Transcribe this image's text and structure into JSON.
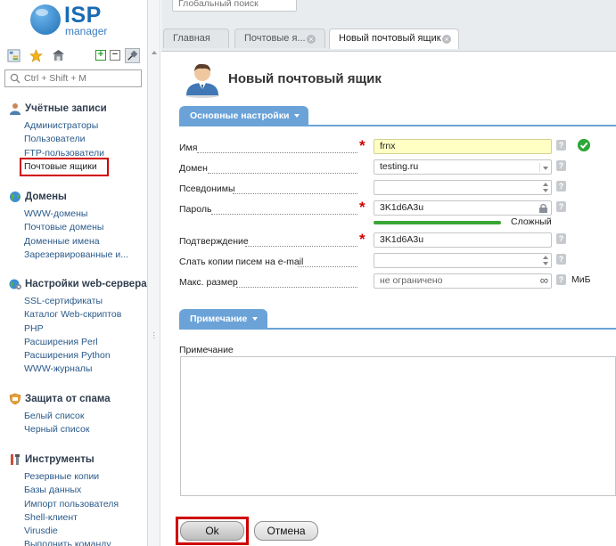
{
  "app": {
    "logo_main": "ISP",
    "logo_sub": "manager"
  },
  "toolbar_icons": [
    "tree-icon",
    "star-icon",
    "home-icon",
    "expand-icon",
    "collapse-icon",
    "pin-icon"
  ],
  "sidebar": {
    "search_placeholder": "Ctrl + Shift + M",
    "groups": [
      {
        "title": "Учётные записи",
        "icon": "users-icon",
        "items": [
          "Администраторы",
          "Пользователи",
          "FTP-пользователи",
          "Почтовые ящики"
        ]
      },
      {
        "title": "Домены",
        "icon": "globe-icon",
        "items": [
          "WWW-домены",
          "Почтовые домены",
          "Доменные имена",
          "Зарезервированные и..."
        ]
      },
      {
        "title": "Настройки web-сервера",
        "icon": "globe-gear-icon",
        "items": [
          "SSL-сертификаты",
          "Каталог Web-скриптов",
          "PHP",
          "Расширения Perl",
          "Расширения Python",
          "WWW-журналы"
        ]
      },
      {
        "title": "Защита от спама",
        "icon": "spam-shield-icon",
        "items": [
          "Белый список",
          "Черный список"
        ]
      },
      {
        "title": "Инструменты",
        "icon": "tools-icon",
        "items": [
          "Резервные копии",
          "Базы данных",
          "Импорт пользователя",
          "Shell-клиент",
          "Virusdie",
          "Выполнить команду"
        ]
      }
    ]
  },
  "top": {
    "global_search_placeholder": "Глобальный поиск"
  },
  "tabs": [
    {
      "label": "Главная"
    },
    {
      "label": "Почтовые я..."
    },
    {
      "label": "Новый почтовый ящик"
    }
  ],
  "form": {
    "title": "Новый почтовый ящик",
    "section_main": "Основные настройки",
    "fields": {
      "name": {
        "label": "Имя",
        "value": "frnx"
      },
      "domain": {
        "label": "Домен",
        "value": "testing.ru"
      },
      "aliases": {
        "label": "Псевдонимы",
        "value": ""
      },
      "password": {
        "label": "Пароль",
        "value": "3K1d6A3u",
        "strength_label": "Сложный"
      },
      "confirm": {
        "label": "Подтверждение",
        "value": "3K1d6A3u"
      },
      "copies": {
        "label": "Слать копии писем на e-mail",
        "value": ""
      },
      "max_size": {
        "label": "Макс. размер",
        "placeholder": "не ограничено",
        "unit": "МиБ"
      }
    },
    "section_note": "Примечание",
    "note_label": "Примечание",
    "note_value": "",
    "help_glyph": "?",
    "required_glyph": "*",
    "buttons": {
      "ok": "Ok",
      "cancel": "Отмена"
    }
  },
  "colors": {
    "accent": "#6ba3d8",
    "required": "#d00000",
    "strength": "#3aa635",
    "highlight_box": "#d00000"
  }
}
